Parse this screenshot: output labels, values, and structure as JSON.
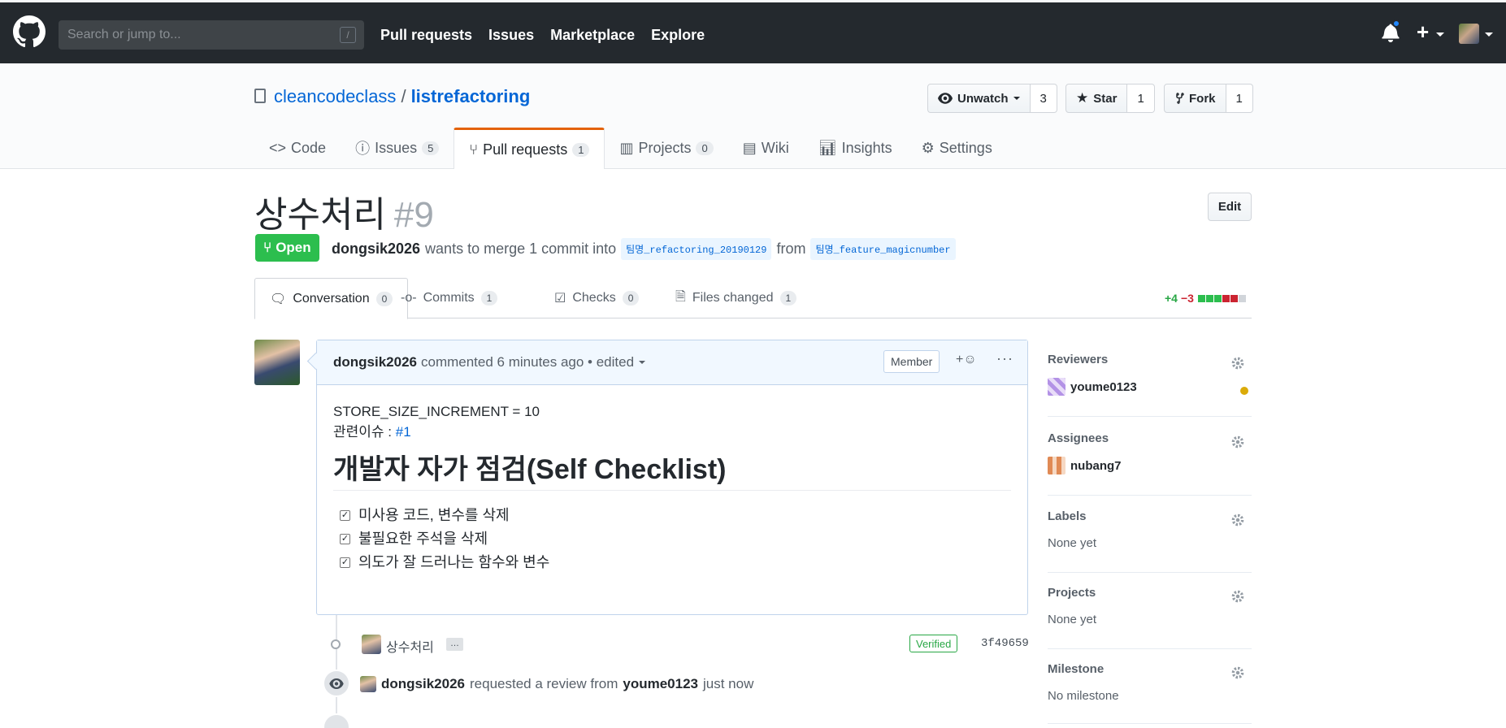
{
  "header": {
    "search_placeholder": "Search or jump to...",
    "search_key": "/",
    "nav": [
      "Pull requests",
      "Issues",
      "Marketplace",
      "Explore"
    ],
    "icons": [
      "github-logo-icon",
      "bell-icon",
      "plus-icon",
      "avatar"
    ]
  },
  "repo": {
    "owner": "cleancodeclass",
    "separator": "/",
    "name": "listrefactoring",
    "unwatch_label": "Unwatch",
    "watch_count": "3",
    "star_label": "Star",
    "star_count": "1",
    "fork_label": "Fork",
    "fork_count": "1",
    "tabs": [
      {
        "label": "Code",
        "count": ""
      },
      {
        "label": "Issues",
        "count": "5"
      },
      {
        "label": "Pull requests",
        "count": "1"
      },
      {
        "label": "Projects",
        "count": "0"
      },
      {
        "label": "Wiki",
        "count": ""
      },
      {
        "label": "Insights",
        "count": ""
      },
      {
        "label": "Settings",
        "count": ""
      }
    ]
  },
  "pr": {
    "title": "상수처리",
    "number": "#9",
    "edit_label": "Edit",
    "state": "Open",
    "author": "dongsik2026",
    "merge_text": "wants to merge 1 commit into",
    "base_branch": "팀명_refactoring_20190129",
    "from_text": "from",
    "head_branch": "팀명_feature_magicnumber",
    "tabs": [
      {
        "label": "Conversation",
        "count": "0"
      },
      {
        "label": "Commits",
        "count": "1"
      },
      {
        "label": "Checks",
        "count": "0"
      },
      {
        "label": "Files changed",
        "count": "1"
      }
    ],
    "additions": "+4",
    "deletions": "−3",
    "diff_blocks": [
      "#2cbe4e",
      "#2cbe4e",
      "#2cbe4e",
      "#cb2431",
      "#cb2431",
      "#d1d5da"
    ]
  },
  "comment": {
    "author": "dongsik2026",
    "meta": "commented 6 minutes ago • edited",
    "badge": "Member",
    "reaction": "+☺",
    "more": "···",
    "line1": "STORE_SIZE_INCREMENT = 10",
    "issue_label": "관련이슈 : ",
    "issue_link": "#1",
    "heading": "개발자 자가 점검(Self Checklist)",
    "tasks": [
      "미사용 코드, 변수를 삭제",
      "불필요한 주석을 삭제",
      "의도가 잘 드러나는 함수와 변수"
    ]
  },
  "timeline": {
    "commit_msg": "상수처리",
    "commit_ellipsis": "…",
    "verified": "Verified",
    "sha": "3f49659",
    "review_author": "dongsik2026",
    "review_text": "requested a review from",
    "reviewer": "youme0123",
    "review_time": "just now"
  },
  "sidebar": {
    "reviewers_title": "Reviewers",
    "reviewer": "youme0123",
    "assignees_title": "Assignees",
    "assignee": "nubang7",
    "labels_title": "Labels",
    "labels_value": "None yet",
    "projects_title": "Projects",
    "projects_value": "None yet",
    "milestone_title": "Milestone",
    "milestone_value": "No milestone"
  }
}
